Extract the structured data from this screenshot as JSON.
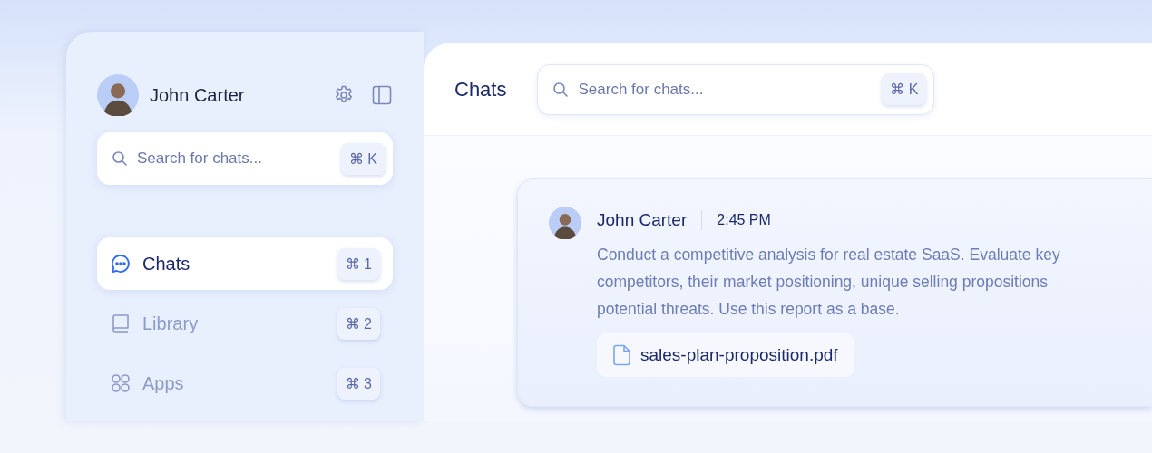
{
  "sidebar": {
    "user": {
      "name": "John Carter"
    },
    "search": {
      "placeholder": "Search for chats...",
      "shortcut": "⌘ K"
    },
    "items": [
      {
        "label": "Chats",
        "shortcut": "⌘ 1",
        "kind": "chat",
        "selected": true
      },
      {
        "label": "Library",
        "shortcut": "⌘ 2",
        "kind": "library",
        "selected": false
      },
      {
        "label": "Apps",
        "shortcut": "⌘ 3",
        "kind": "apps",
        "selected": false
      }
    ]
  },
  "main": {
    "title": "Chats",
    "search": {
      "placeholder": "Search for chats...",
      "shortcut": "⌘ K"
    },
    "messages": [
      {
        "author": "John Carter",
        "time": "2:45 PM",
        "lines": [
          "Conduct a competitive analysis for real estate SaaS. Evaluate key",
          "competitors, their market positioning, unique selling propositions",
          "potential threats. Use this report as a base."
        ],
        "attachment": "sales-plan-proposition.pdf"
      }
    ]
  }
}
